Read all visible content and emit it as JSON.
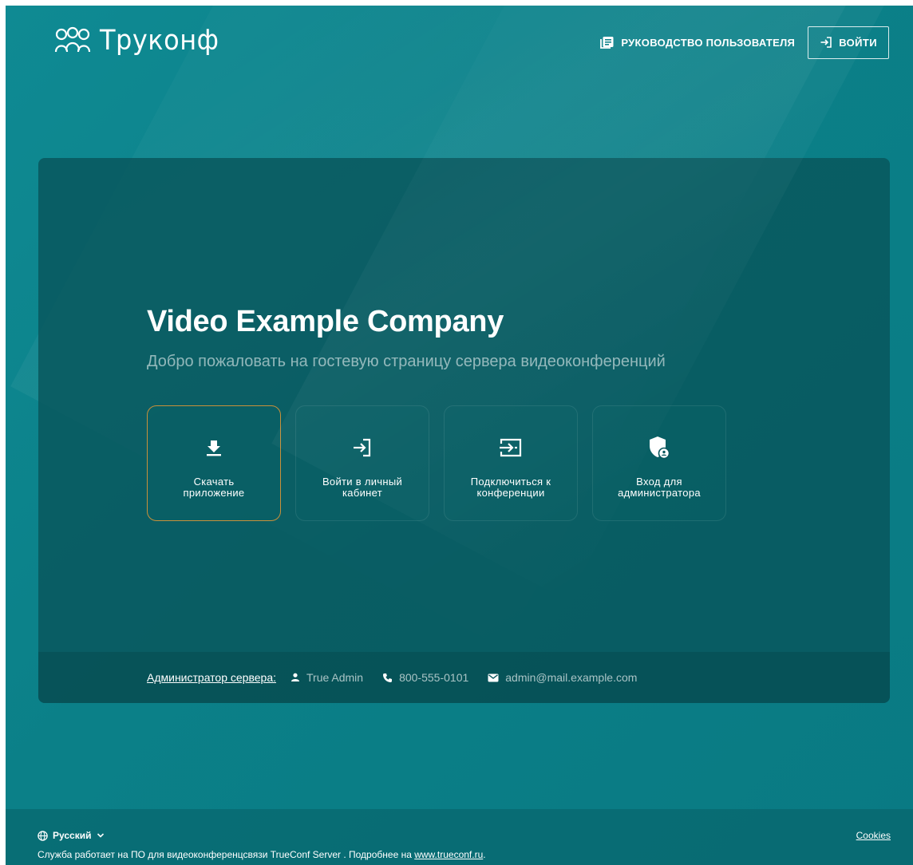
{
  "header": {
    "logo_text": "Труконф",
    "user_guide_label": "РУКОВОДСТВО ПОЛЬЗОВАТЕЛЯ",
    "login_label": "ВОЙТИ"
  },
  "main": {
    "title": "Video Example Company",
    "subtitle": "Добро пожаловать на гостевую страницу сервера видеоконференций",
    "tiles": [
      {
        "label": "Скачать\nприложение",
        "icon": "download-icon"
      },
      {
        "label": "Войти в личный\nкабинет",
        "icon": "login-icon"
      },
      {
        "label": "Подключиться к\nконференции",
        "icon": "join-conference-icon"
      },
      {
        "label": "Вход для\nадминистратора",
        "icon": "admin-shield-icon"
      }
    ],
    "admin": {
      "label": "Администратор сервера:",
      "name": "True Admin",
      "phone": "800-555-0101",
      "email": "admin@mail.example.com"
    }
  },
  "footer": {
    "language": "Русский",
    "cookies_label": "Cookies",
    "note_prefix": "Служба работает на ПО для видеоконференцсвязи TrueConf Server . Подробнее на ",
    "note_link": "www.trueconf.ru",
    "note_suffix": "."
  },
  "colors": {
    "background": "#0b8088",
    "card": "#08565c",
    "active_tile_border": "#c8903a"
  }
}
